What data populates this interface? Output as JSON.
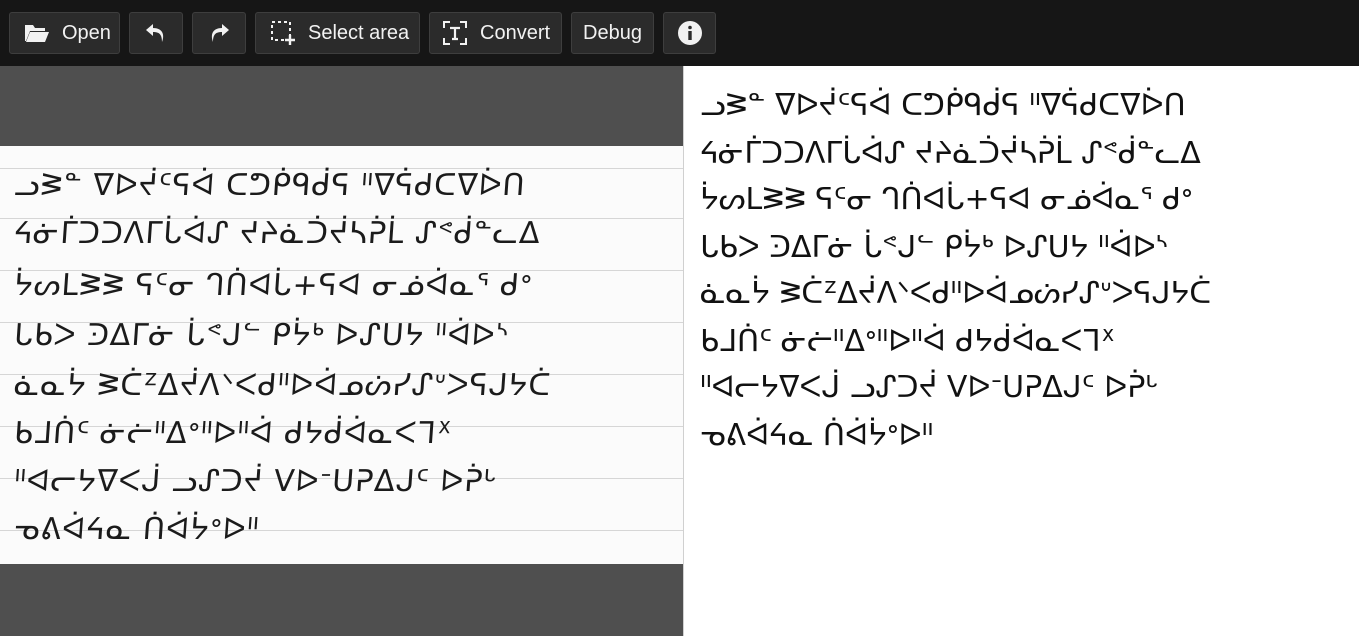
{
  "toolbar": {
    "open_label": "Open",
    "select_area_label": "Select area",
    "convert_label": "Convert",
    "debug_label": "Debug",
    "icons": {
      "open": "folder-open-icon",
      "undo": "undo-icon",
      "redo": "redo-icon",
      "select_area": "select-area-icon",
      "convert": "text-convert-icon",
      "info": "info-icon"
    },
    "background_color": "#161616",
    "button_color": "#2b2b2b"
  },
  "image_pane": {
    "background_color": "#4f4f4f",
    "lines": [
      "ᓗᕒᓐ ᐁᐅᔫᑦᕋᐋ ᑕᕤᑮᑫᑰᕋ ᐦᐁᕌᑯᑕᐁᐆᑎ",
      "ᔦᓃᒦᑐᑐᐱᒥᒑᐋᔑ ᔪᔨᓈᑑᔫᓴᕉᒫ ᔑᕝᑰᓐᓚᐃ",
      "ᔮᔕᒪᕒᕒ ᕋᑦᓂ ᒉᑏᐊᒑ+ᕋᐊ ᓂᓅᐋᓇᕐ ᑯᐤ",
      "ᒐᑲᐳ ᑔᐃᒥᓃ ᒑᕝᒍᓪ ᑭᔮᒃ ᐅᔑᑌᔭ ᐦᐋᐅᔅ",
      "ᓈᓇᔮ ᕒᑖᙆᐃᔫᐱᐠᐸᑯᐦᐅᐋᓄᔖᓯᔑᐡᐳᕋᒍᔭᑖ",
      "ᑲᒧᑏᑦ ᓃᓖᐦᐃᐤᐦᐅᐦᐋ ᑯᔭᑰᐋᓇᐸᒣᕽ",
      "ᐦᐊᓕᔭᐁᐸᒎ ᓗᔑᑐᔫ ᐯᐅᐨᑌᕈᐃᒍᑦ ᐅᕉᒡ",
      "ᓀᕕᐋᔦᓇ ᑏᐋᔮᐤᐅᐦ"
    ]
  },
  "output_pane": {
    "lines": [
      "ᓗᕒᓐ ᐁᐅᔫᑦᕋᐋ ᑕᕤᑮᑫᑰᕋ ᐦᐁᕌᑯᑕᐁᐆᑎ",
      "ᔦᓃᒦᑐᑐᐱᒥᒑᐋᔑ ᔪᔨᓈᑑᔫᓴᕉᒫ ᔑᕝᑰᓐᓚᐃ",
      "ᔮᔕᒪᕒᕒ ᕋᑦᓂ ᒉᑏᐊᒑ+ᕋᐊ ᓂᓅᐋᓇᕐ ᑯᐤ",
      "ᒐᑲᐳ ᑔᐃᒥᓃ ᒑᕝᒍᓪ ᑭᔮᒃ ᐅᔑᑌᔭ ᐦᐋᐅᔅ",
      "ᓈᓇᔮ ᕒᑖᙆᐃᔫᐱᐠᐸᑯᐦᐅᐋᓄᔖᓯᔑᐡᐳᕋᒍᔭᑖ",
      "ᑲᒧᑏᑦ ᓃᓖᐦᐃᐤᐦᐅᐦᐋ ᑯᔭᑰᐋᓇᐸᒣᕽ",
      "ᐦᐊᓕᔭᐁᐸᒎ ᓗᔑᑐᔫ ᐯᐅᐨᑌᕈᐃᒍᑦ ᐅᕉᒡ",
      "ᓀᕕᐋᔦᓇ ᑏᐋᔮᐤᐅᐦ"
    ]
  }
}
